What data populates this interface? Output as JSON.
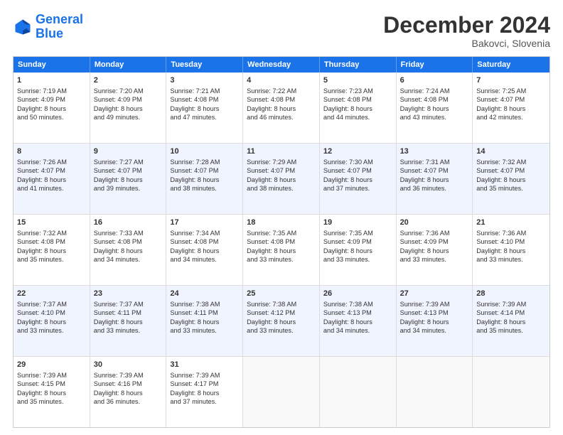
{
  "logo": {
    "line1": "General",
    "line2": "Blue"
  },
  "title": "December 2024",
  "subtitle": "Bakovci, Slovenia",
  "header_days": [
    "Sunday",
    "Monday",
    "Tuesday",
    "Wednesday",
    "Thursday",
    "Friday",
    "Saturday"
  ],
  "weeks": [
    {
      "alt": false,
      "cells": [
        {
          "day": "1",
          "lines": [
            "Sunrise: 7:19 AM",
            "Sunset: 4:09 PM",
            "Daylight: 8 hours",
            "and 50 minutes."
          ]
        },
        {
          "day": "2",
          "lines": [
            "Sunrise: 7:20 AM",
            "Sunset: 4:09 PM",
            "Daylight: 8 hours",
            "and 49 minutes."
          ]
        },
        {
          "day": "3",
          "lines": [
            "Sunrise: 7:21 AM",
            "Sunset: 4:08 PM",
            "Daylight: 8 hours",
            "and 47 minutes."
          ]
        },
        {
          "day": "4",
          "lines": [
            "Sunrise: 7:22 AM",
            "Sunset: 4:08 PM",
            "Daylight: 8 hours",
            "and 46 minutes."
          ]
        },
        {
          "day": "5",
          "lines": [
            "Sunrise: 7:23 AM",
            "Sunset: 4:08 PM",
            "Daylight: 8 hours",
            "and 44 minutes."
          ]
        },
        {
          "day": "6",
          "lines": [
            "Sunrise: 7:24 AM",
            "Sunset: 4:08 PM",
            "Daylight: 8 hours",
            "and 43 minutes."
          ]
        },
        {
          "day": "7",
          "lines": [
            "Sunrise: 7:25 AM",
            "Sunset: 4:07 PM",
            "Daylight: 8 hours",
            "and 42 minutes."
          ]
        }
      ]
    },
    {
      "alt": true,
      "cells": [
        {
          "day": "8",
          "lines": [
            "Sunrise: 7:26 AM",
            "Sunset: 4:07 PM",
            "Daylight: 8 hours",
            "and 41 minutes."
          ]
        },
        {
          "day": "9",
          "lines": [
            "Sunrise: 7:27 AM",
            "Sunset: 4:07 PM",
            "Daylight: 8 hours",
            "and 39 minutes."
          ]
        },
        {
          "day": "10",
          "lines": [
            "Sunrise: 7:28 AM",
            "Sunset: 4:07 PM",
            "Daylight: 8 hours",
            "and 38 minutes."
          ]
        },
        {
          "day": "11",
          "lines": [
            "Sunrise: 7:29 AM",
            "Sunset: 4:07 PM",
            "Daylight: 8 hours",
            "and 38 minutes."
          ]
        },
        {
          "day": "12",
          "lines": [
            "Sunrise: 7:30 AM",
            "Sunset: 4:07 PM",
            "Daylight: 8 hours",
            "and 37 minutes."
          ]
        },
        {
          "day": "13",
          "lines": [
            "Sunrise: 7:31 AM",
            "Sunset: 4:07 PM",
            "Daylight: 8 hours",
            "and 36 minutes."
          ]
        },
        {
          "day": "14",
          "lines": [
            "Sunrise: 7:32 AM",
            "Sunset: 4:07 PM",
            "Daylight: 8 hours",
            "and 35 minutes."
          ]
        }
      ]
    },
    {
      "alt": false,
      "cells": [
        {
          "day": "15",
          "lines": [
            "Sunrise: 7:32 AM",
            "Sunset: 4:08 PM",
            "Daylight: 8 hours",
            "and 35 minutes."
          ]
        },
        {
          "day": "16",
          "lines": [
            "Sunrise: 7:33 AM",
            "Sunset: 4:08 PM",
            "Daylight: 8 hours",
            "and 34 minutes."
          ]
        },
        {
          "day": "17",
          "lines": [
            "Sunrise: 7:34 AM",
            "Sunset: 4:08 PM",
            "Daylight: 8 hours",
            "and 34 minutes."
          ]
        },
        {
          "day": "18",
          "lines": [
            "Sunrise: 7:35 AM",
            "Sunset: 4:08 PM",
            "Daylight: 8 hours",
            "and 33 minutes."
          ]
        },
        {
          "day": "19",
          "lines": [
            "Sunrise: 7:35 AM",
            "Sunset: 4:09 PM",
            "Daylight: 8 hours",
            "and 33 minutes."
          ]
        },
        {
          "day": "20",
          "lines": [
            "Sunrise: 7:36 AM",
            "Sunset: 4:09 PM",
            "Daylight: 8 hours",
            "and 33 minutes."
          ]
        },
        {
          "day": "21",
          "lines": [
            "Sunrise: 7:36 AM",
            "Sunset: 4:10 PM",
            "Daylight: 8 hours",
            "and 33 minutes."
          ]
        }
      ]
    },
    {
      "alt": true,
      "cells": [
        {
          "day": "22",
          "lines": [
            "Sunrise: 7:37 AM",
            "Sunset: 4:10 PM",
            "Daylight: 8 hours",
            "and 33 minutes."
          ]
        },
        {
          "day": "23",
          "lines": [
            "Sunrise: 7:37 AM",
            "Sunset: 4:11 PM",
            "Daylight: 8 hours",
            "and 33 minutes."
          ]
        },
        {
          "day": "24",
          "lines": [
            "Sunrise: 7:38 AM",
            "Sunset: 4:11 PM",
            "Daylight: 8 hours",
            "and 33 minutes."
          ]
        },
        {
          "day": "25",
          "lines": [
            "Sunrise: 7:38 AM",
            "Sunset: 4:12 PM",
            "Daylight: 8 hours",
            "and 33 minutes."
          ]
        },
        {
          "day": "26",
          "lines": [
            "Sunrise: 7:38 AM",
            "Sunset: 4:13 PM",
            "Daylight: 8 hours",
            "and 34 minutes."
          ]
        },
        {
          "day": "27",
          "lines": [
            "Sunrise: 7:39 AM",
            "Sunset: 4:13 PM",
            "Daylight: 8 hours",
            "and 34 minutes."
          ]
        },
        {
          "day": "28",
          "lines": [
            "Sunrise: 7:39 AM",
            "Sunset: 4:14 PM",
            "Daylight: 8 hours",
            "and 35 minutes."
          ]
        }
      ]
    },
    {
      "alt": false,
      "cells": [
        {
          "day": "29",
          "lines": [
            "Sunrise: 7:39 AM",
            "Sunset: 4:15 PM",
            "Daylight: 8 hours",
            "and 35 minutes."
          ]
        },
        {
          "day": "30",
          "lines": [
            "Sunrise: 7:39 AM",
            "Sunset: 4:16 PM",
            "Daylight: 8 hours",
            "and 36 minutes."
          ]
        },
        {
          "day": "31",
          "lines": [
            "Sunrise: 7:39 AM",
            "Sunset: 4:17 PM",
            "Daylight: 8 hours",
            "and 37 minutes."
          ]
        },
        {
          "day": "",
          "lines": []
        },
        {
          "day": "",
          "lines": []
        },
        {
          "day": "",
          "lines": []
        },
        {
          "day": "",
          "lines": []
        }
      ]
    }
  ]
}
